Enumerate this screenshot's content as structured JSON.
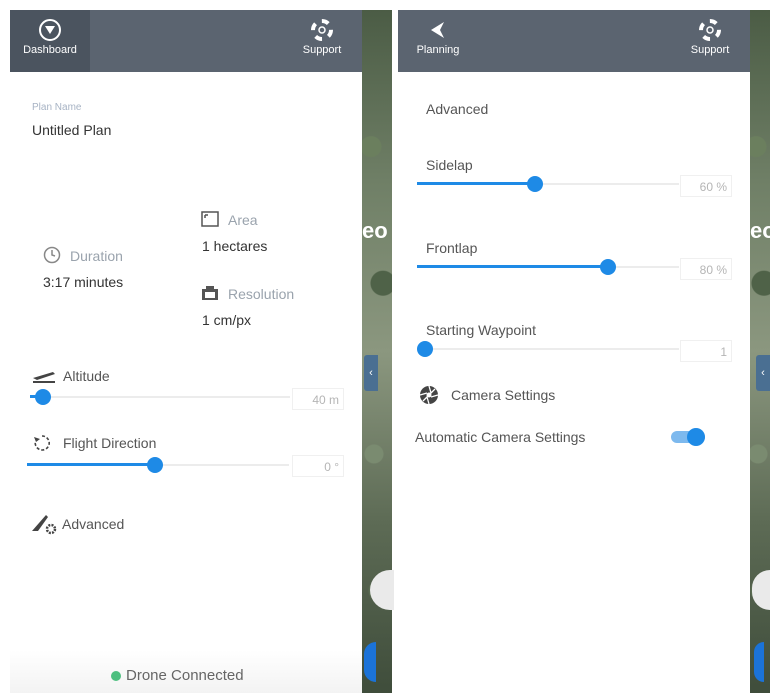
{
  "left_panel": {
    "header": {
      "dashboard_label": "Dashboard",
      "support_label": "Support"
    },
    "plan_name_label": "Plan Name",
    "plan_name_value": "Untitled Plan",
    "area_label": "Area",
    "area_value": "1 hectares",
    "duration_label": "Duration",
    "duration_value": "3:17 minutes",
    "resolution_label": "Resolution",
    "resolution_value": "1 cm/px",
    "altitude_label": "Altitude",
    "altitude_value": "40 m",
    "altitude_fraction": 0.05,
    "flight_direction_label": "Flight Direction",
    "flight_direction_value": "0 °",
    "flight_direction_fraction": 0.49,
    "advanced_label": "Advanced",
    "status_text": "Drone Connected",
    "status_color": "#4dbf7f"
  },
  "right_panel": {
    "header": {
      "back_label": "Planning",
      "support_label": "Support"
    },
    "section_title": "Advanced",
    "sidelap_label": "Sidelap",
    "sidelap_value": "60 %",
    "sidelap_fraction": 0.45,
    "frontlap_label": "Frontlap",
    "frontlap_value": "80 %",
    "frontlap_fraction": 0.73,
    "starting_waypoint_label": "Starting Waypoint",
    "starting_waypoint_value": "1",
    "starting_waypoint_fraction": 0.0,
    "camera_settings_label": "Camera Settings",
    "auto_camera_label": "Automatic Camera Settings",
    "auto_camera_on": true
  },
  "map_label": "eo",
  "colors": {
    "accent": "#1e8ae6",
    "header": "#5b6470"
  }
}
